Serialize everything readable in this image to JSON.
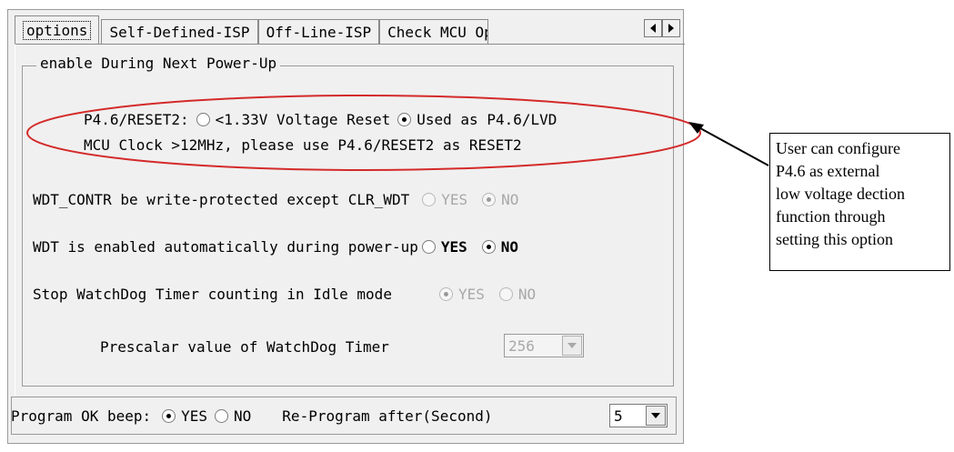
{
  "tabs": [
    {
      "label": "options",
      "active": true
    },
    {
      "label": "Self-Defined-ISP",
      "active": false
    },
    {
      "label": "Off-Line-ISP",
      "active": false
    },
    {
      "label": "Check MCU Option",
      "active": false
    }
  ],
  "tab_scroll": {
    "left_icon": "triangle-left-icon",
    "right_icon": "triangle-right-icon"
  },
  "group": {
    "legend": "enable During Next Power-Up"
  },
  "reset2": {
    "label": "P4.6/RESET2:",
    "option1": "<1.33V Voltage Reset",
    "option2": "Used as P4.6/LVD",
    "selected": "option2",
    "note": "MCU Clock >12MHz, please use P4.6/RESET2 as RESET2"
  },
  "wdt_protect": {
    "label": "WDT_CONTR be write-protected except CLR_WDT",
    "yes": "YES",
    "no": "NO",
    "selected": "no",
    "enabled": false
  },
  "wdt_auto": {
    "label": "WDT is enabled automatically during power-up",
    "yes": "YES",
    "no": "NO",
    "selected": "no",
    "enabled": true
  },
  "wdt_idle": {
    "label": "Stop WatchDog Timer counting in Idle mode",
    "yes": "YES",
    "no": "NO",
    "selected": "yes",
    "enabled": false
  },
  "prescalar": {
    "label": "Prescalar value of WatchDog Timer",
    "value": "256",
    "enabled": false
  },
  "bottom": {
    "beep_label": "Program OK beep:",
    "yes": "YES",
    "no": "NO",
    "selected": "yes",
    "reprogram_label": "Re-Program after(Second)",
    "reprogram_value": "5"
  },
  "annotation": {
    "lines": [
      "User can configure",
      "P4.6 as external",
      "low voltage dection",
      "function through",
      "setting this option"
    ],
    "ellipse_color": "#d42a2a"
  }
}
